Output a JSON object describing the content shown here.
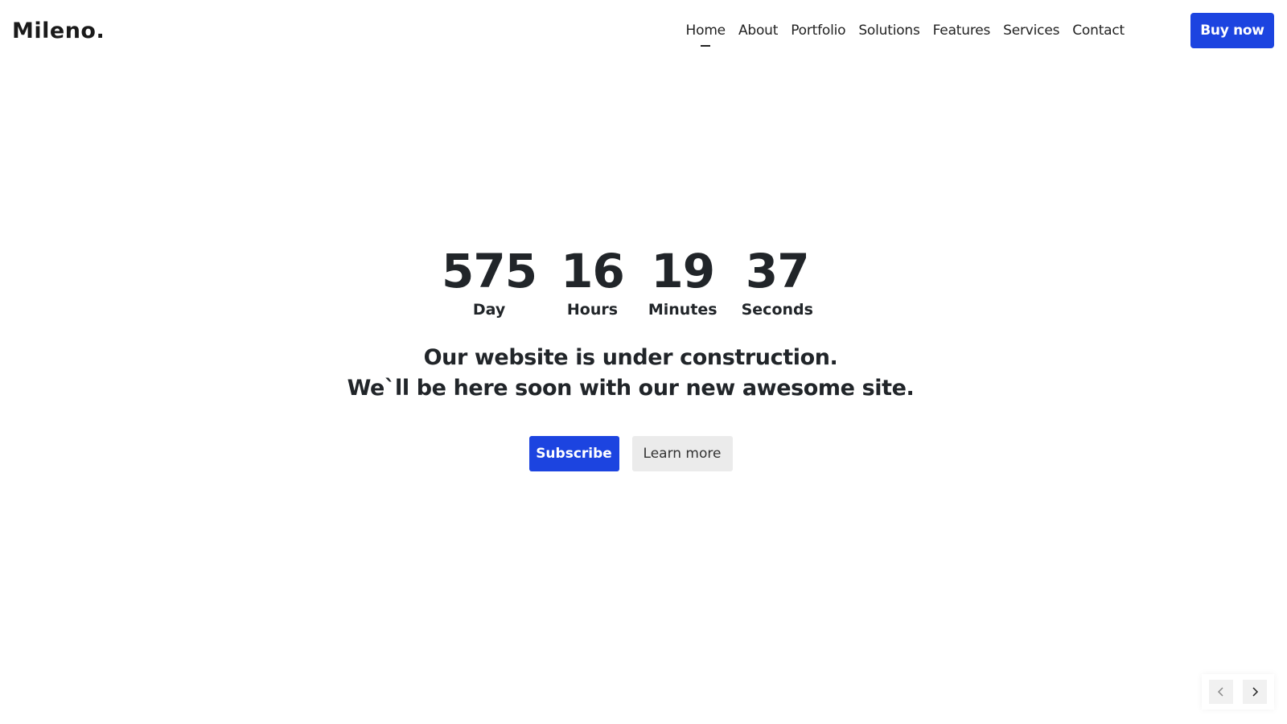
{
  "header": {
    "logo": "Mileno.",
    "nav": [
      {
        "label": "Home",
        "active": true
      },
      {
        "label": "About"
      },
      {
        "label": "Portfolio"
      },
      {
        "label": "Solutions"
      },
      {
        "label": "Features"
      },
      {
        "label": "Services"
      },
      {
        "label": "Contact"
      }
    ],
    "buy_label": "Buy now"
  },
  "countdown": [
    {
      "value": "575",
      "label": "Day"
    },
    {
      "value": "16",
      "label": "Hours"
    },
    {
      "value": "19",
      "label": "Minutes"
    },
    {
      "value": "37",
      "label": "Seconds"
    }
  ],
  "message": {
    "line1": "Our website is under construction.",
    "line2": "We`ll be here soon with our new awesome site."
  },
  "actions": {
    "subscribe_label": "Subscribe",
    "learn_more_label": "Learn more"
  },
  "slider": {
    "prev_icon": "chevron-left-icon",
    "next_icon": "chevron-right-icon"
  },
  "colors": {
    "accent": "#1c44e0",
    "text": "#212529",
    "secondary_button": "#ebebeb"
  }
}
